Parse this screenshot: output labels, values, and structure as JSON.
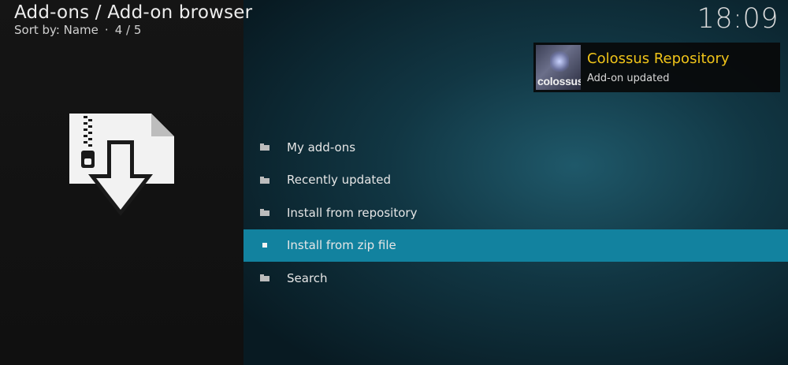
{
  "header": {
    "title": "Add-ons / Add-on browser",
    "sort_label": "Sort by: Name",
    "position": "4 / 5"
  },
  "clock": "18:09",
  "notification": {
    "title": "Colossus Repository",
    "message": "Add-on updated",
    "thumbnail_text": "colossus",
    "title_color": "#f0c419"
  },
  "menu": {
    "items": [
      {
        "label": "My add-ons",
        "icon": "folder-icon"
      },
      {
        "label": "Recently updated",
        "icon": "folder-icon"
      },
      {
        "label": "Install from repository",
        "icon": "folder-icon"
      },
      {
        "label": "Install from zip file",
        "icon": "square-icon",
        "selected": true
      },
      {
        "label": "Search",
        "icon": "folder-icon"
      }
    ],
    "selected_color": "#12829f"
  },
  "preview_icon": "zip-install-icon"
}
